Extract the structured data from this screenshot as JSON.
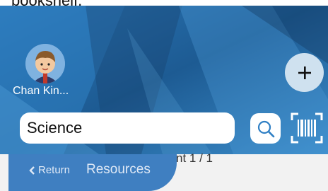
{
  "header": {
    "top_text": "bookshelf."
  },
  "user": {
    "name": "Chan Kin..."
  },
  "search": {
    "value": "Science"
  },
  "results": {
    "count_text": "nt 1 / 1"
  },
  "nav": {
    "return_label": "Return",
    "title": "Resources"
  },
  "colors": {
    "accent": "#3f7fc1",
    "bg_dark": "#1f5d94",
    "bg_light": "#4f9bd8"
  },
  "icons": {
    "avatar": "avatar-boy-icon",
    "add": "plus-icon",
    "search": "search-icon",
    "scan": "barcode-scan-icon",
    "back": "chevron-left-icon"
  }
}
